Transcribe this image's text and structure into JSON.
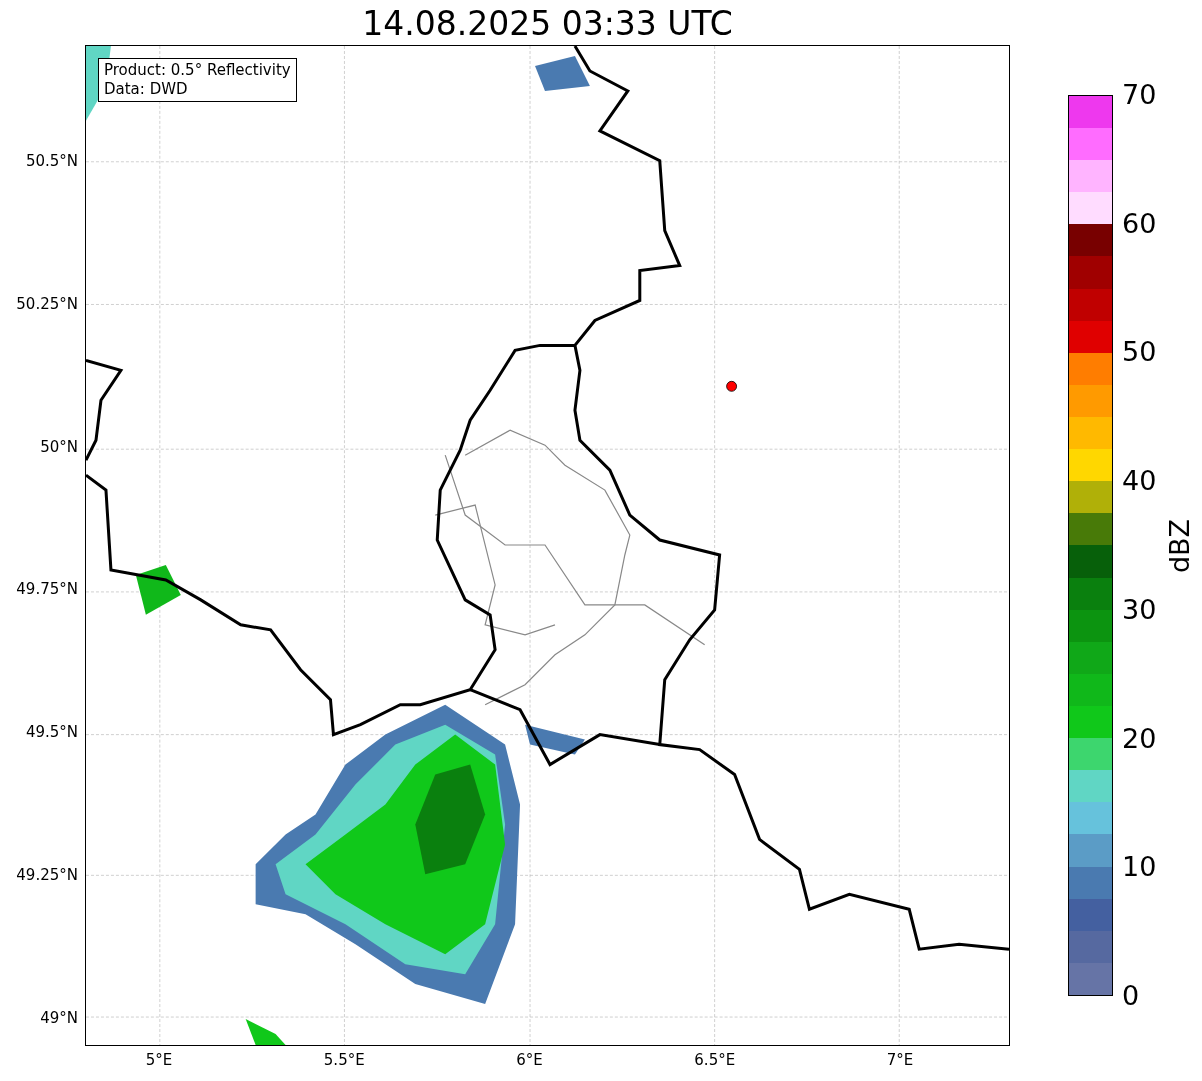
{
  "title": "14.08.2025 03:33 UTC",
  "legend": {
    "lines": [
      "Product: 0.5° Reflectivity",
      "Data: DWD"
    ]
  },
  "y_ticks": [
    "50.5°N",
    "50.25°N",
    "50°N",
    "49.75°N",
    "49.5°N",
    "49.25°N",
    "49°N"
  ],
  "x_ticks": [
    "5°E",
    "5.5°E",
    "6°E",
    "6.5°E",
    "7°E"
  ],
  "colorbar": {
    "label": "dBZ",
    "ticks": [
      "70",
      "60",
      "50",
      "40",
      "30",
      "20",
      "10",
      "0"
    ],
    "segments": [
      {
        "color": "#6674a6"
      },
      {
        "color": "#5669a0"
      },
      {
        "color": "#4460a0"
      },
      {
        "color": "#4a7ab0"
      },
      {
        "color": "#5b9cc6"
      },
      {
        "color": "#66c2dc"
      },
      {
        "color": "#60d6c4"
      },
      {
        "color": "#3dd66e"
      },
      {
        "color": "#10c81a"
      },
      {
        "color": "#10b81a"
      },
      {
        "color": "#10a818"
      },
      {
        "color": "#0c9410"
      },
      {
        "color": "#0a800e"
      },
      {
        "color": "#07600a"
      },
      {
        "color": "#487a08"
      },
      {
        "color": "#b0b008"
      },
      {
        "color": "#ffd700"
      },
      {
        "color": "#ffb900"
      },
      {
        "color": "#ff9a00"
      },
      {
        "color": "#ff7d00"
      },
      {
        "color": "#e00000"
      },
      {
        "color": "#c00000"
      },
      {
        "color": "#a00000"
      },
      {
        "color": "#780000"
      },
      {
        "color": "#ffdcff"
      },
      {
        "color": "#ffb4ff"
      },
      {
        "color": "#ff6cff"
      },
      {
        "color": "#ee38ee"
      }
    ]
  }
}
